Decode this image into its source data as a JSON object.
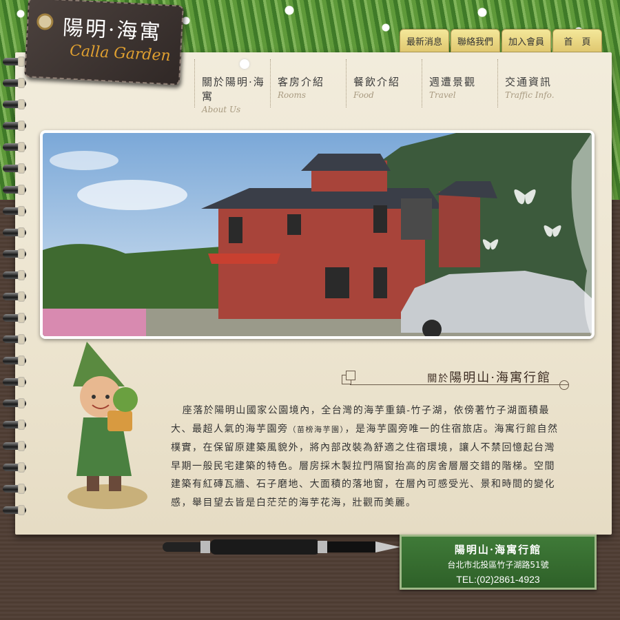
{
  "logo": {
    "name_cn": "陽明·海寓",
    "name_en": "Calla Garden"
  },
  "top_tabs": [
    "最新消息",
    "聯絡我們",
    "加入會員",
    "首　頁"
  ],
  "nav": [
    {
      "cn": "關於陽明·海寓",
      "en": "About Us"
    },
    {
      "cn": "客房介紹",
      "en": "Rooms"
    },
    {
      "cn": "餐飲介紹",
      "en": "Food"
    },
    {
      "cn": "週遭景觀",
      "en": "Travel"
    },
    {
      "cn": "交通資訊",
      "en": "Traffic Info."
    }
  ],
  "section": {
    "prefix": "關於",
    "title": "陽明山·海寓行館"
  },
  "paragraph": {
    "part1": "座落於陽明山國家公園境內，全台灣的海芋重鎮-竹子湖，依傍著竹子湖面積最大、最超人氣的海芋園旁",
    "note": "（苗榜海芋園）",
    "part2": "，是海芋園旁唯一的住宿旅店。海寓行館自然樸實，在保留原建築風貌外，將內部改裝為舒適之住宿環境，讓人不禁回憶起台灣早期一般民宅建築的特色。層房採木製拉門隔窗抬高的房舍層層交錯的階梯。空間建築有紅磚瓦牆、石子磨地、大面積的落地窗，在層內可感受光、景和時間的變化感，舉目望去皆是白茫茫的海芋花海，壯觀而美麗。"
  },
  "contact": {
    "name": "陽明山·海寓行館",
    "address": "台北市北投區竹子湖路51號",
    "tel": "TEL:(02)2861-4923"
  },
  "icons": [
    "flower-icon",
    "pen-icon",
    "butterfly-icon"
  ]
}
